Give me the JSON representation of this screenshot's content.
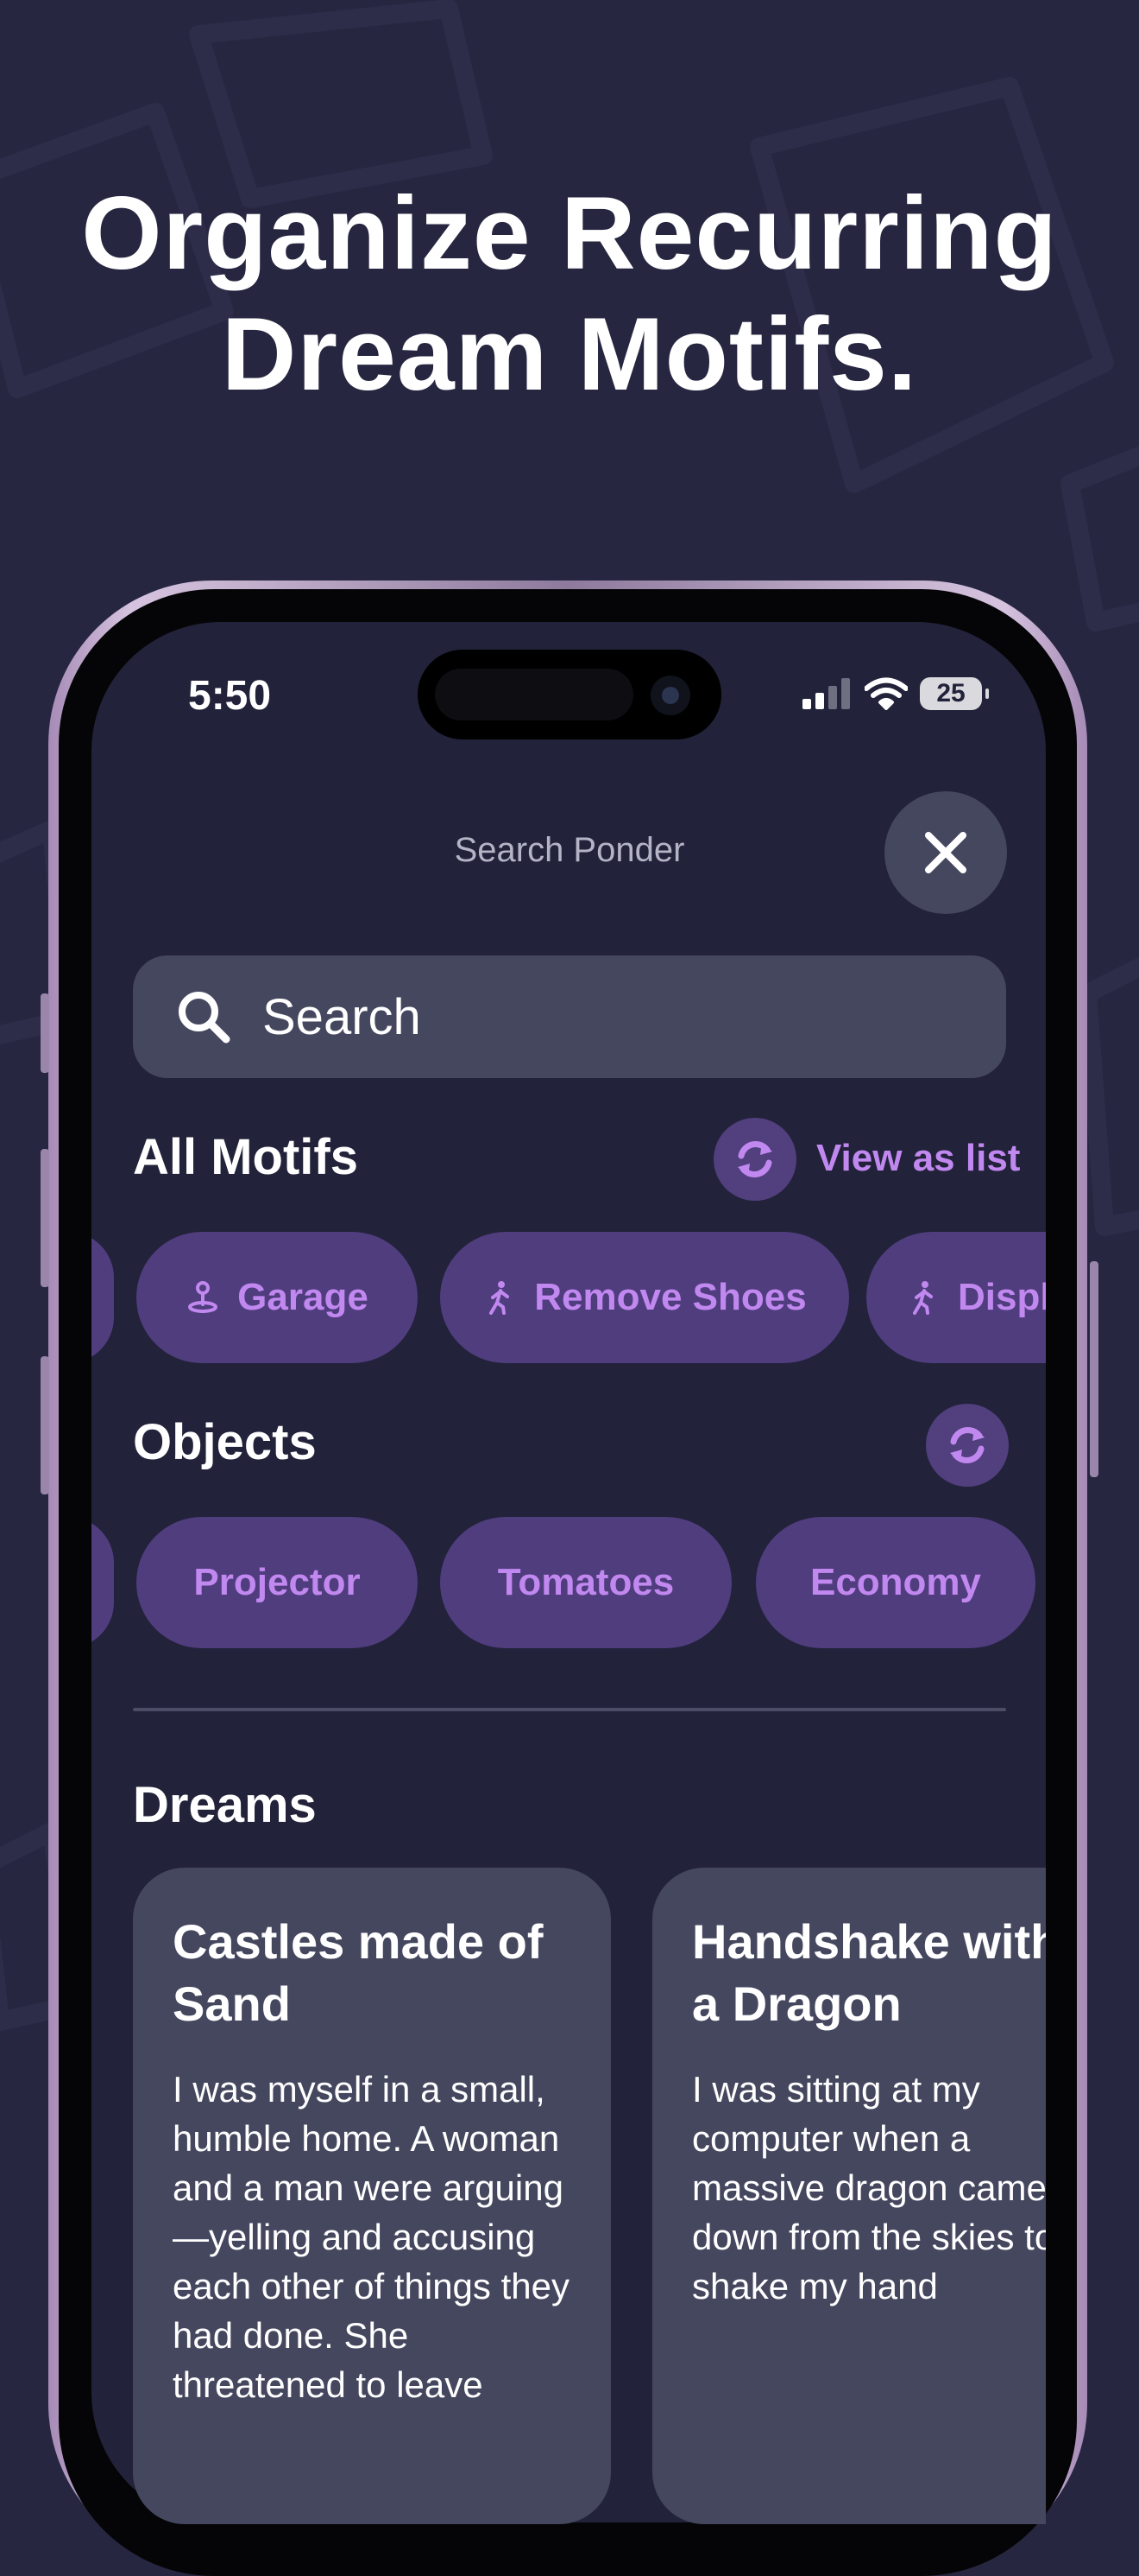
{
  "headline": {
    "line1": "Organize Recurring",
    "line2": "Dream Motifs."
  },
  "status_bar": {
    "time": "5:50",
    "battery": "25",
    "icons": [
      "signal-icon",
      "wifi-icon",
      "battery-icon"
    ]
  },
  "screen": {
    "title": "Search Ponder",
    "close_icon": "close-icon"
  },
  "search": {
    "placeholder": "Search",
    "icon": "search-icon"
  },
  "all_motifs": {
    "title": "All Motifs",
    "view_as_list": "View as list",
    "chips": [
      {
        "label": "Garage",
        "icon": "location-pin-icon"
      },
      {
        "label": "Remove Shoes",
        "icon": "walking-person-icon"
      },
      {
        "label": "Display",
        "icon": "walking-person-icon"
      }
    ]
  },
  "objects": {
    "title": "Objects",
    "chips": [
      {
        "label": "Projector"
      },
      {
        "label": "Tomatoes"
      },
      {
        "label": "Economy"
      }
    ]
  },
  "dreams": {
    "title": "Dreams",
    "cards": [
      {
        "title": "Castles made of Sand",
        "body": "I was myself in a small, humble home. A woman and a man were arguing—yelling and accusing each other of things they had done. She threatened to leave"
      },
      {
        "title": "Handshake with a Dragon",
        "body": "I was sitting at my computer when a massive dragon came down from the skies to shake my hand"
      }
    ]
  },
  "colors": {
    "background": "#262640",
    "screen": "#22223a",
    "surface": "#45475f",
    "chip": "#503d7e",
    "accent": "#c188f0"
  }
}
